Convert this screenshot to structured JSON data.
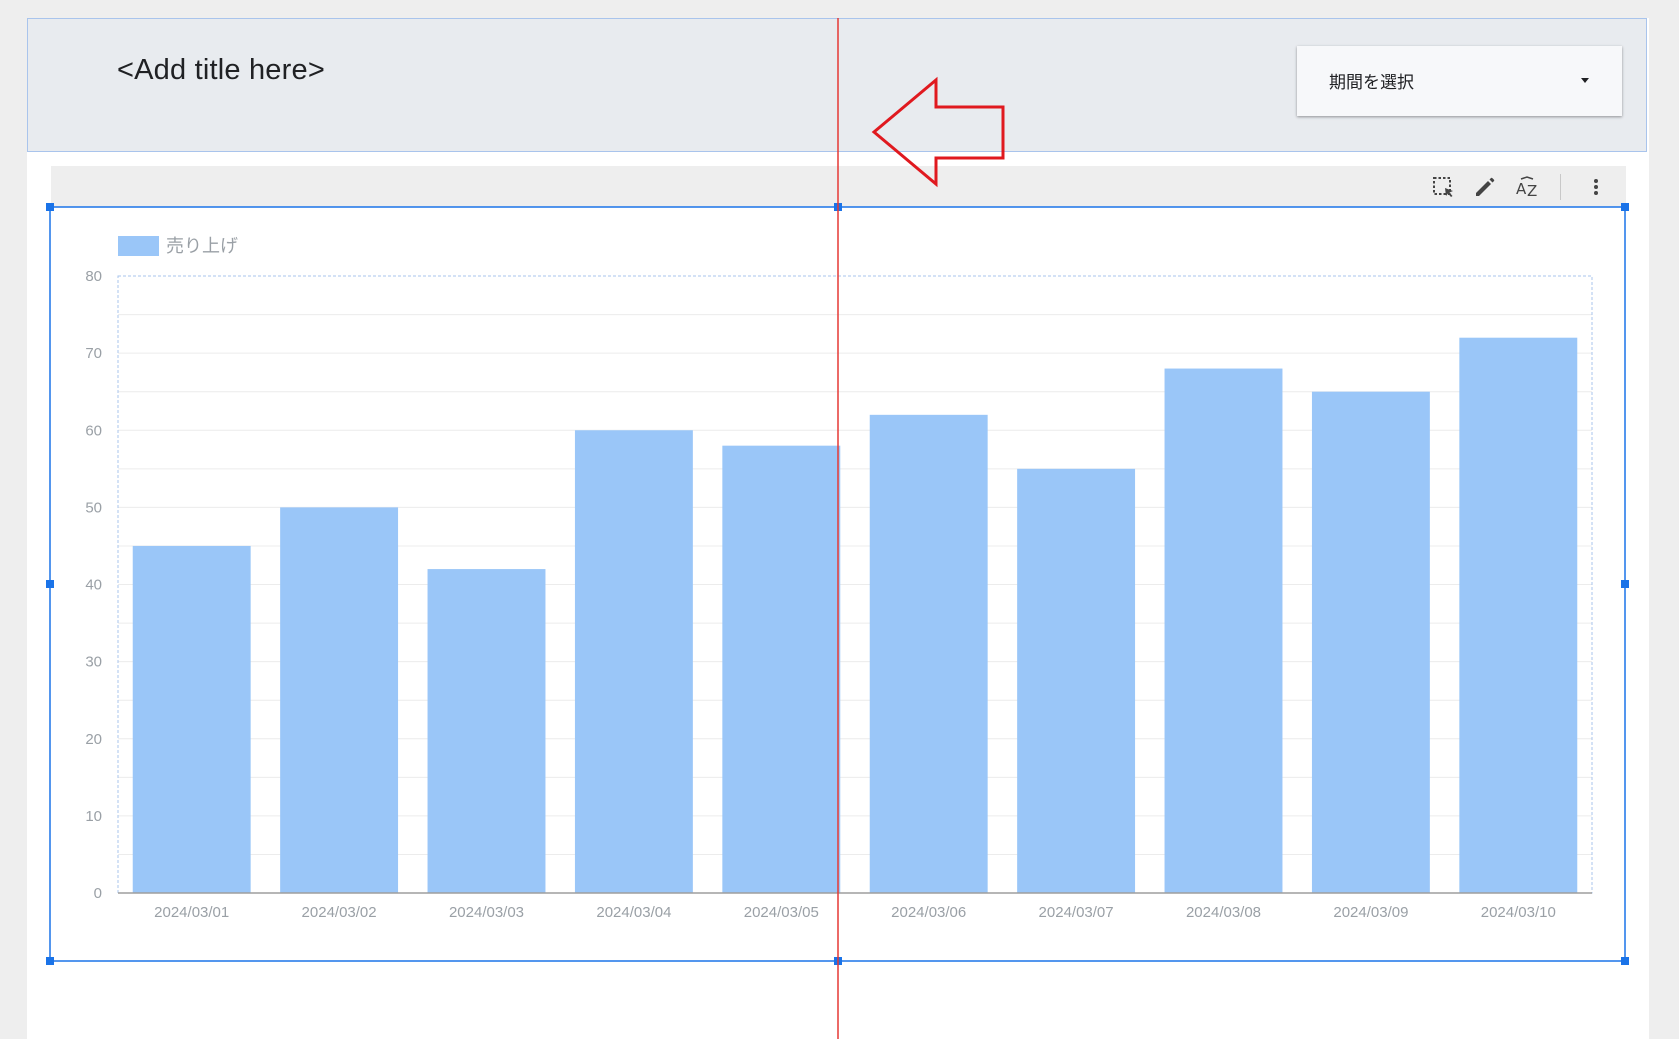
{
  "header": {
    "title": "<Add title here>",
    "date_picker_label": "期間を選択"
  },
  "toolbar": {
    "icons": [
      "select-area-icon",
      "pencil-icon",
      "sort-az-icon",
      "more-vert-icon"
    ]
  },
  "colors": {
    "bar": "#9ac6f8",
    "selection": "#1a73e8",
    "guide_line": "#e53935",
    "annotation_arrow": "#e0191f",
    "header_bg": "#e8ebef"
  },
  "chart_data": {
    "type": "bar",
    "legend": "売り上げ",
    "legend_position": "top-left",
    "categories": [
      "2024/03/01",
      "2024/03/02",
      "2024/03/03",
      "2024/03/04",
      "2024/03/05",
      "2024/03/06",
      "2024/03/07",
      "2024/03/08",
      "2024/03/09",
      "2024/03/10"
    ],
    "series": [
      {
        "name": "売り上げ",
        "values": [
          45,
          50,
          42,
          60,
          58,
          62,
          55,
          68,
          65,
          72
        ]
      }
    ],
    "ylim": [
      0,
      80
    ],
    "yticks": [
      0,
      10,
      20,
      30,
      40,
      50,
      60,
      70,
      80
    ],
    "grid": true
  }
}
